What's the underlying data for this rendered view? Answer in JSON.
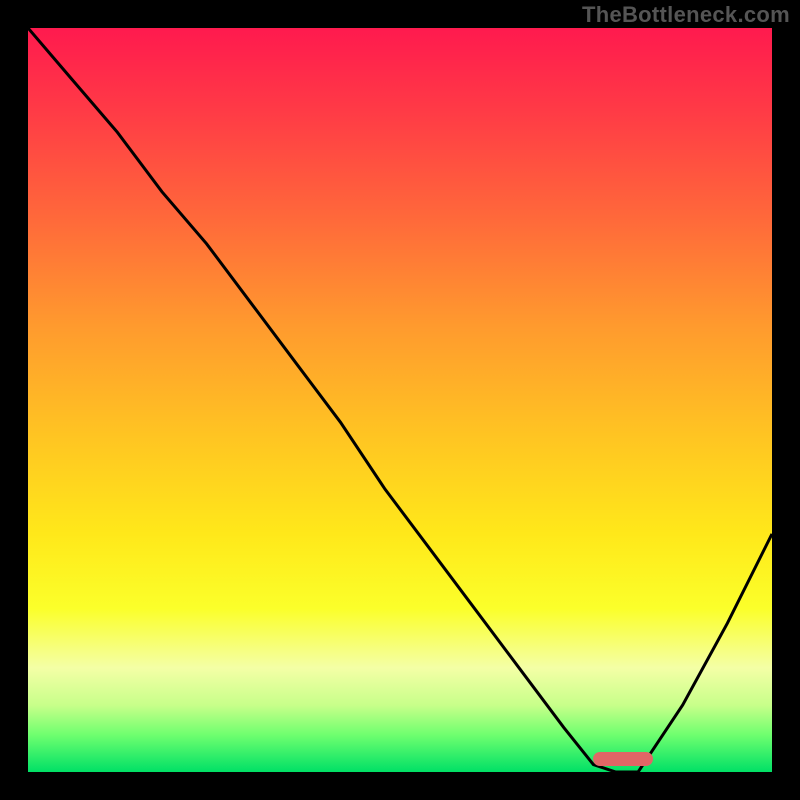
{
  "watermark": "TheBottleneck.com",
  "colors": {
    "background": "#000000",
    "gradient_top": "#ff1a4e",
    "gradient_bottom": "#00e066",
    "curve": "#000000",
    "marker": "#e06666"
  },
  "chart_data": {
    "type": "line",
    "title": "",
    "xlabel": "",
    "ylabel": "",
    "xlim": [
      0,
      100
    ],
    "ylim": [
      0,
      100
    ],
    "x": [
      0,
      6,
      12,
      18,
      24,
      30,
      36,
      42,
      48,
      54,
      60,
      66,
      72,
      76,
      79,
      82,
      88,
      94,
      100
    ],
    "values": [
      100,
      93,
      86,
      78,
      71,
      63,
      55,
      47,
      38,
      30,
      22,
      14,
      6,
      1,
      0,
      0,
      9,
      20,
      32
    ],
    "annotations": [
      {
        "name": "optimal-range-marker",
        "x_start": 76,
        "x_end": 84,
        "y": 0.5
      }
    ]
  }
}
